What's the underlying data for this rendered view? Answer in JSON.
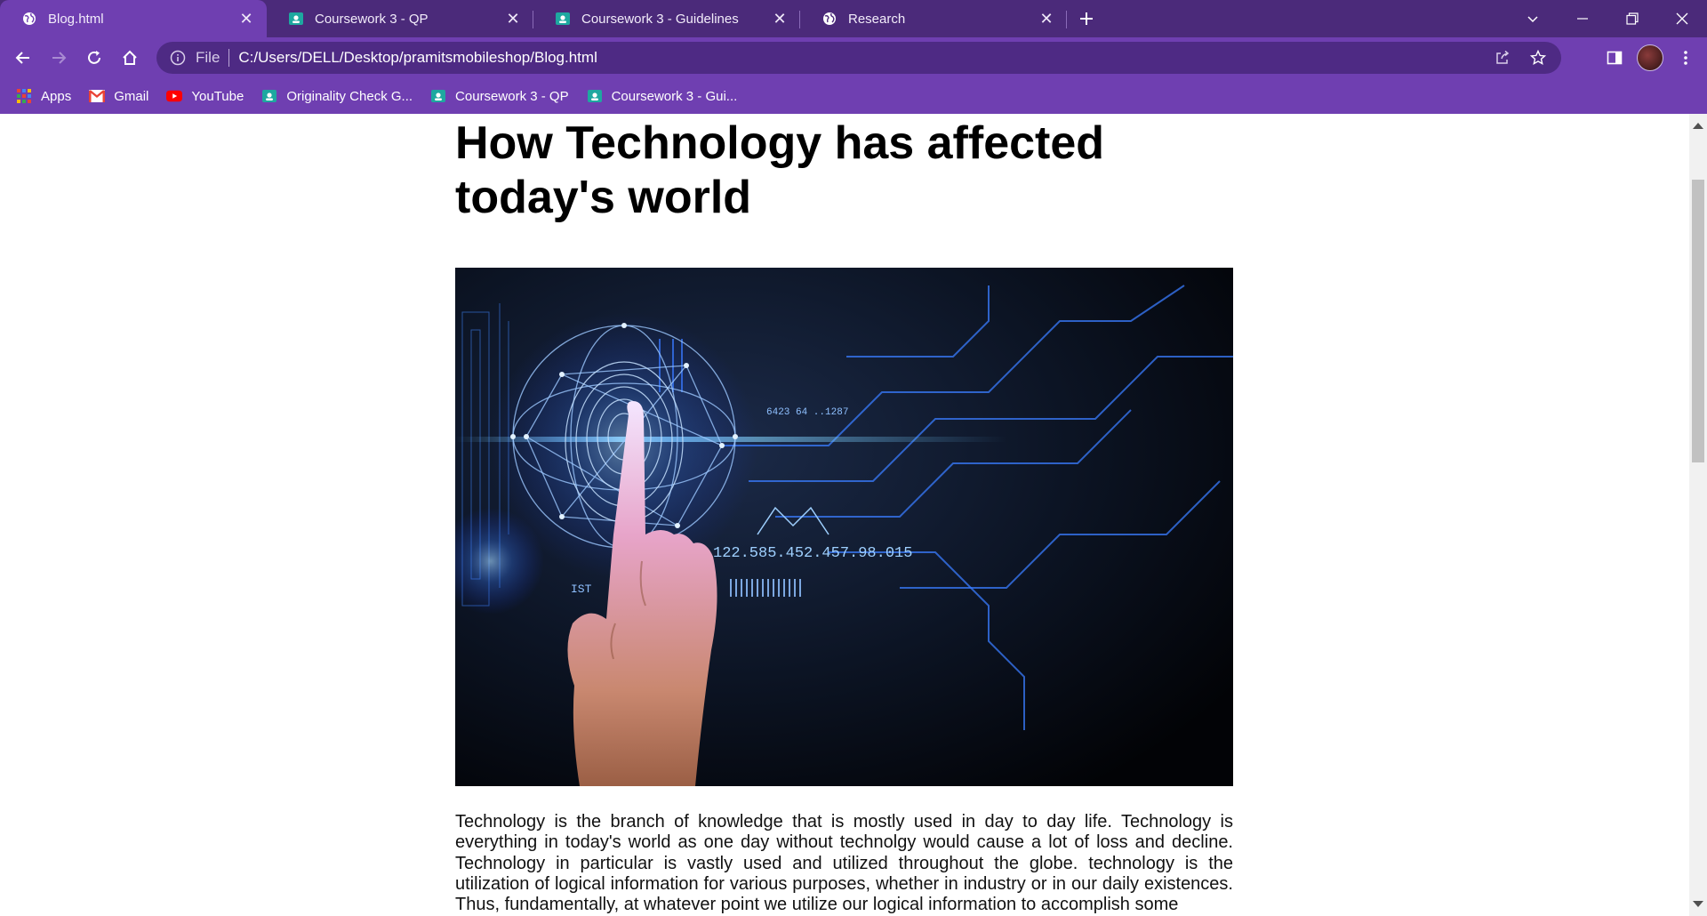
{
  "browser": {
    "tabs": [
      {
        "title": "Blog.html",
        "favicon": "globe-icon",
        "active": true
      },
      {
        "title": "Coursework 3 - QP",
        "favicon": "classroom-icon",
        "active": false
      },
      {
        "title": "Coursework 3 - Guidelines",
        "favicon": "classroom-icon",
        "active": false
      },
      {
        "title": "Research",
        "favicon": "globe-icon",
        "active": false
      }
    ],
    "address": {
      "scheme_label": "File",
      "url": "C:/Users/DELL/Desktop/pramitsmobileshop/Blog.html"
    },
    "bookmarks": [
      {
        "label": "Apps",
        "icon": "apps-grid-icon"
      },
      {
        "label": "Gmail",
        "icon": "gmail-icon"
      },
      {
        "label": "YouTube",
        "icon": "youtube-icon"
      },
      {
        "label": "Originality Check G...",
        "icon": "classroom-icon"
      },
      {
        "label": "Coursework 3 - QP",
        "icon": "classroom-icon"
      },
      {
        "label": "Coursework 3 - Gui...",
        "icon": "classroom-icon"
      }
    ],
    "colors": {
      "tabbar": "#4b2a7a",
      "toolbar": "#6f3fb1",
      "omnibox": "#4e2a84"
    }
  },
  "page": {
    "heading": "How Technology has affected today's world",
    "image_subject": "hand touching glowing blue digital fingerprint",
    "image_overlay_texts": [
      "6423 64 ..1287",
      "122.585.452.457.98.015",
      "IST"
    ],
    "paragraph": "Technology is the branch of knowledge that is mostly used in day to day life. Technology is everything in today's world as one day without technolgy would cause a lot of loss and decline. Technology in particular is vastly used and utilized throughout the globe. technology is the utilization of logical information for various purposes, whether in industry or in our daily existences. Thus, fundamentally, at whatever point we utilize our logical information to accomplish some"
  }
}
